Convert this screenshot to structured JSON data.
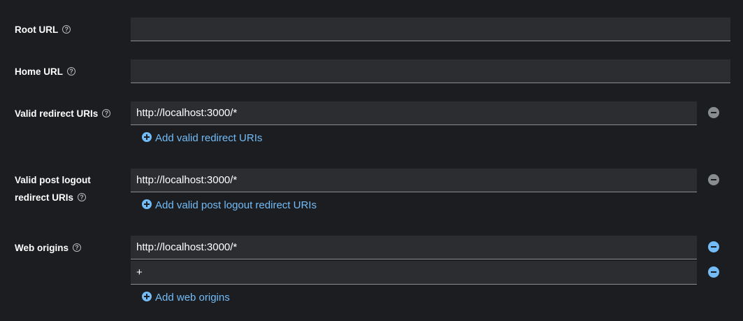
{
  "fields": {
    "root_url": {
      "label": "Root URL",
      "value": ""
    },
    "home_url": {
      "label": "Home URL",
      "value": ""
    },
    "valid_redirect": {
      "label": "Valid redirect URIs",
      "values": [
        "http://localhost:3000/*"
      ],
      "add_label": "Add valid redirect URIs"
    },
    "post_logout": {
      "label_line1": "Valid post logout",
      "label_line2": "redirect URIs",
      "values": [
        "http://localhost:3000/*"
      ],
      "add_label": "Add valid post logout redirect URIs"
    },
    "web_origins": {
      "label": "Web origins",
      "values": [
        "http://localhost:3000/*",
        "+"
      ],
      "add_label": "Add web origins"
    }
  },
  "help_glyph": "?",
  "colors": {
    "background": "#1b1d21",
    "input_bg": "#2c2d31",
    "link": "#73bcf7",
    "remove_disabled": "#8a8d90"
  },
  "icons": {
    "help": "help-circle-icon",
    "remove": "minus-circle-icon",
    "add": "plus-circle-icon"
  }
}
